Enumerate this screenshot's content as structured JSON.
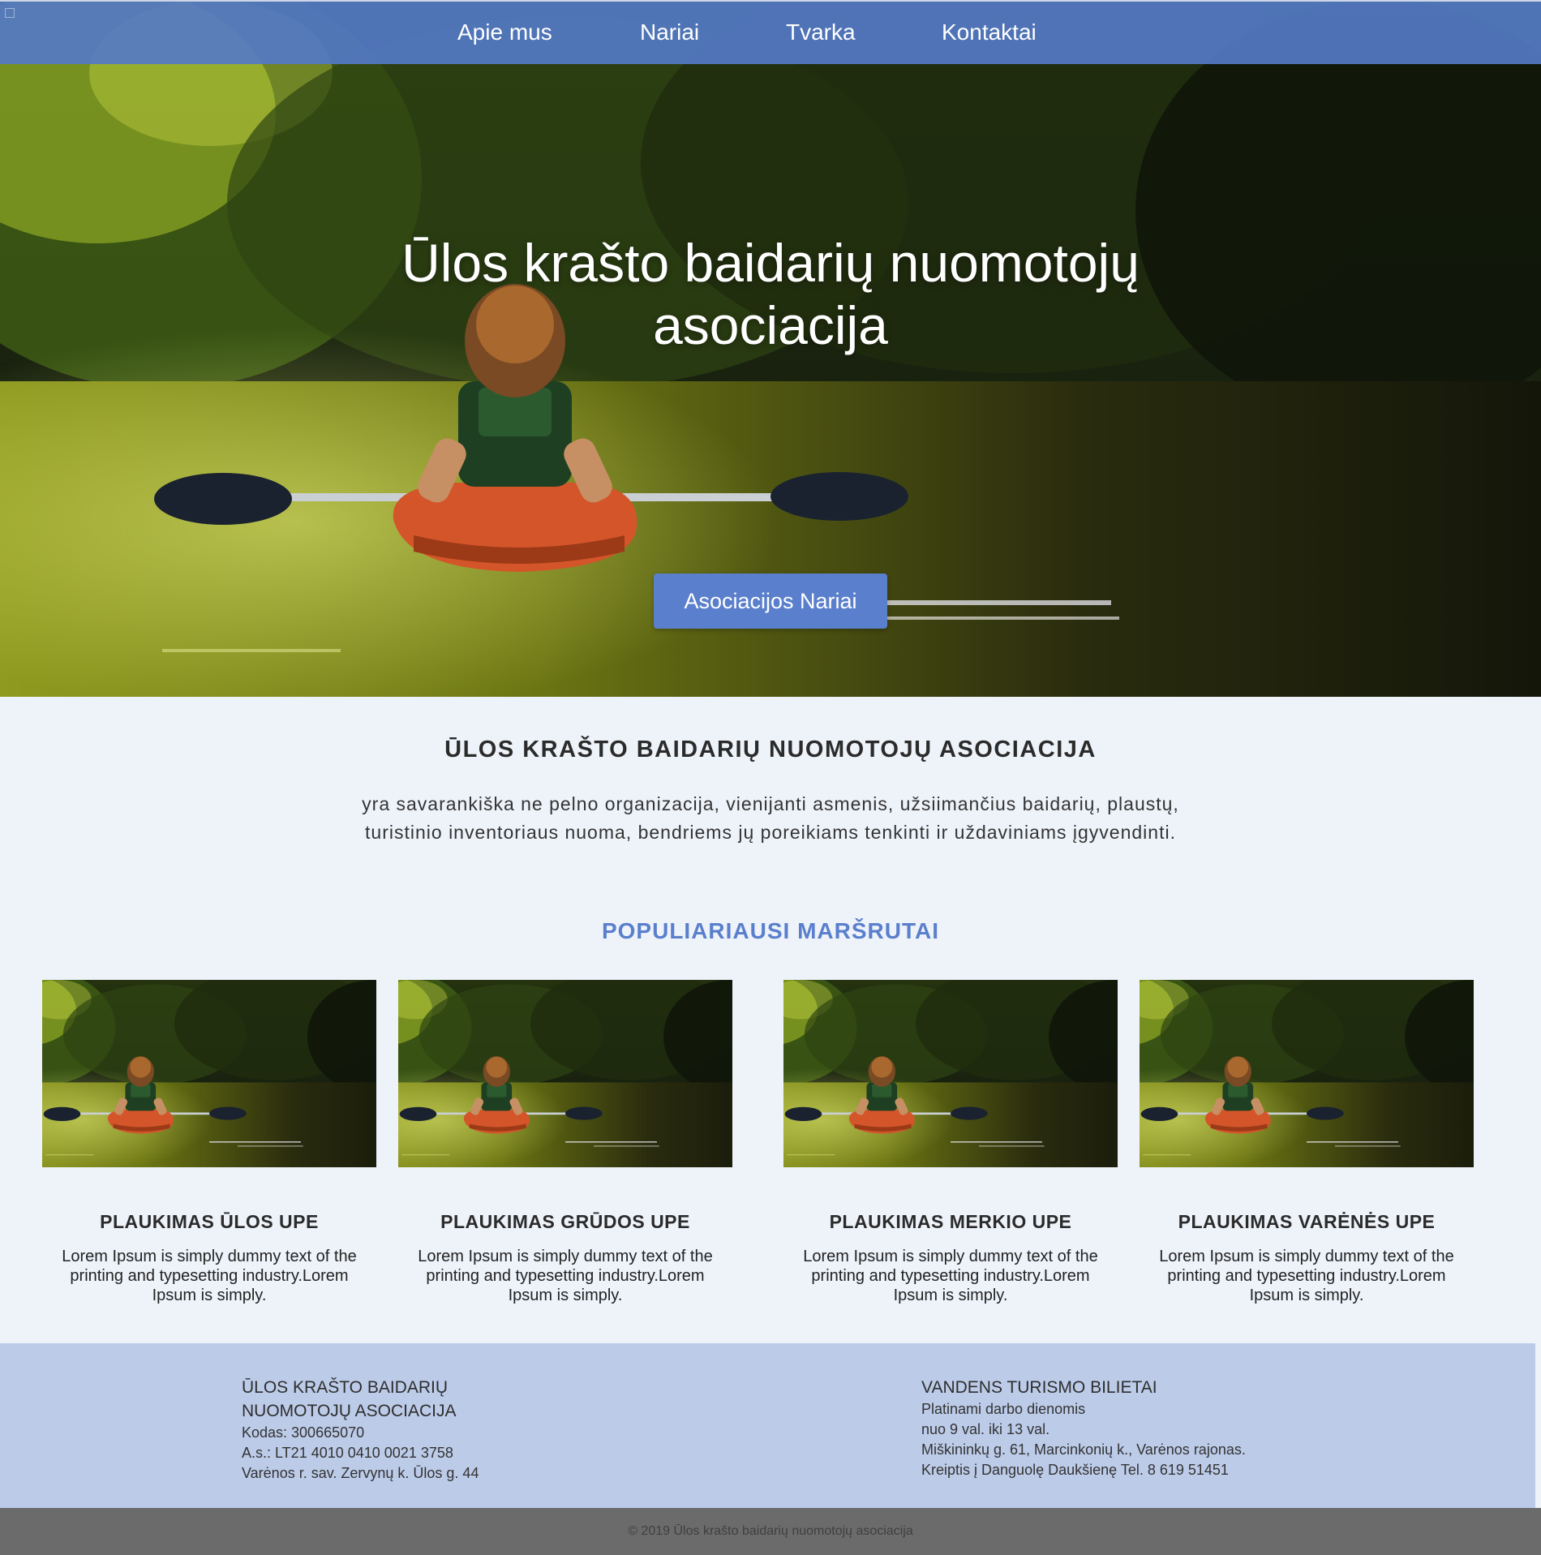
{
  "nav": {
    "items": [
      {
        "label": "Apie mus"
      },
      {
        "label": "Nariai"
      },
      {
        "label": "Tvarka"
      },
      {
        "label": "Kontaktai"
      }
    ]
  },
  "hero": {
    "title": "Ūlos krašto baidarių nuomotojų asociacija",
    "button_label": "Asociacijos Nariai"
  },
  "intro": {
    "heading": "ŪLOS KRAŠTO BAIDARIŲ NUOMOTOJŲ ASOCIACIJA",
    "text": "yra savarankiška ne pelno organizacija, vienijanti asmenis, užsiimančius baidarių, plaustų, turistinio inventoriaus nuoma, bendriems jų poreikiams tenkinti ir uždaviniams įgyvendinti."
  },
  "routes": {
    "heading": "POPULIARIAUSI MARŠRUTAI",
    "cards": [
      {
        "title": "PLAUKIMAS ŪLOS UPE",
        "text": "Lorem Ipsum is simply dummy text of the printing and typesetting industry.Lorem Ipsum is simply."
      },
      {
        "title": "PLAUKIMAS GRŪDOS UPE",
        "text": "Lorem Ipsum is simply dummy text of the printing and typesetting industry.Lorem Ipsum is simply."
      },
      {
        "title": "PLAUKIMAS MERKIO UPE",
        "text": "Lorem Ipsum is simply dummy text of the printing and typesetting industry.Lorem Ipsum is simply."
      },
      {
        "title": "PLAUKIMAS VARĖNĖS UPE",
        "text": "Lorem Ipsum is simply dummy text of the printing and typesetting industry.Lorem Ipsum is simply."
      }
    ]
  },
  "footer": {
    "left": {
      "title_line1": "ŪLOS KRAŠTO BAIDARIŲ",
      "title_line2": "NUOMOTOJŲ ASOCIACIJA",
      "code": "Kodas: 300665070",
      "account": "A.s.: LT21 4010 0410 0021 3758",
      "address": "Varėnos r. sav. Zervynų k. Ūlos g. 44"
    },
    "right": {
      "title": "VANDENS TURISMO BILIETAI",
      "line1": "Platinami darbo dienomis",
      "line2": "nuo 9 val. iki 13 val.",
      "line3": "Miškininkų g. 61, Marcinkonių k., Varėnos rajonas.",
      "line4": "Kreiptis į Danguolę Daukšienę Tel. 8 619 51451"
    },
    "copyright": "© 2019 Ūlos krašto baidarių nuomotojų asociacija"
  },
  "colors": {
    "accent": "#5a7fcc",
    "nav_bg": "#547ac4",
    "footer_bg": "#bccbe8",
    "copyright_bg": "#6b6b6b",
    "page_bg": "#eef3fa"
  }
}
